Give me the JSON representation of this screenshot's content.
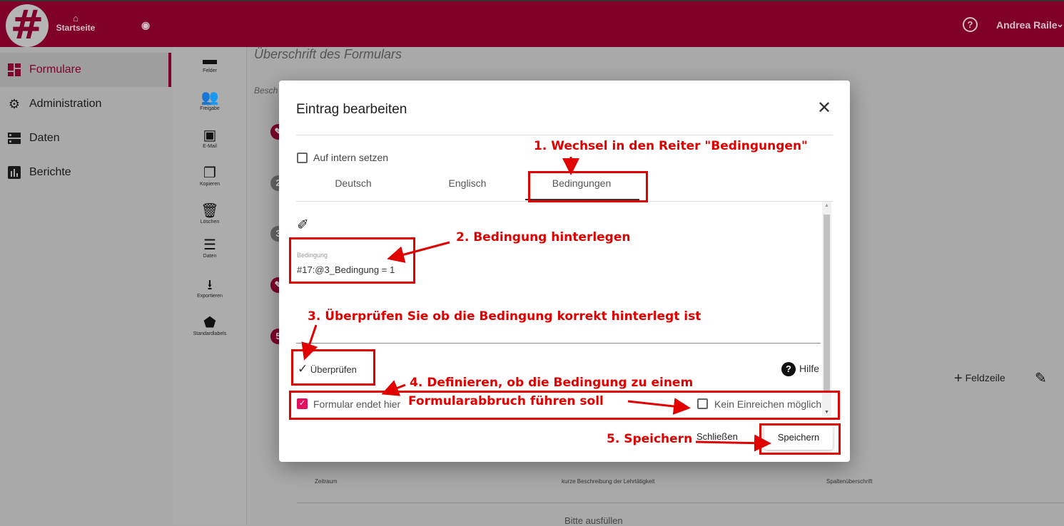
{
  "header": {
    "home_label": "Startseite",
    "user_name": "Andrea Raile",
    "brand_color": "#7f0029"
  },
  "sidebar": {
    "items": [
      {
        "label": "Formulare",
        "icon": "dashboard-icon",
        "active": true
      },
      {
        "label": "Administration",
        "icon": "gear-icon"
      },
      {
        "label": "Daten",
        "icon": "storage-icon"
      },
      {
        "label": "Berichte",
        "icon": "bar-chart-icon"
      }
    ]
  },
  "toolbar": {
    "items": [
      {
        "label": "Felder"
      },
      {
        "label": "Freigabe"
      },
      {
        "label": "E-Mail"
      },
      {
        "label": "Kopieren"
      },
      {
        "label": "Löschen"
      },
      {
        "label": "Daten"
      },
      {
        "label": "Exportieren"
      },
      {
        "label": "Standardlabels"
      }
    ]
  },
  "main": {
    "form_title": "Überschrift des Formulars",
    "desc_partial": "Besch",
    "step_numbers": [
      "2",
      "3",
      "5"
    ],
    "add_row_label": "Feldzeile",
    "table_headers": [
      "Zeitraum",
      "kurze Beschreibung der Lehrtätigkeit",
      "Spaltenüberschrift"
    ],
    "placeholder_row": "Bitte ausfüllen"
  },
  "dialog": {
    "title": "Eintrag bearbeiten",
    "internal_checkbox": {
      "label": "Auf intern setzen",
      "checked": false
    },
    "tabs": [
      "Deutsch",
      "Englisch",
      "Bedingungen"
    ],
    "active_tab": "Bedingungen",
    "condition_label": "Bedingung",
    "condition_value": "#17:@3_Bedingung = 1",
    "check_button": "Überprüfen",
    "help_label": "Hilfe",
    "form_ends_checkbox": {
      "label": "Formular endet hier",
      "checked": true
    },
    "no_submit_checkbox": {
      "label": "Kein Einreichen möglich",
      "checked": false
    },
    "close_button": "Schließen",
    "save_button": "Speichern"
  },
  "annotations": {
    "step1": "1. Wechsel in den Reiter \"Bedingungen\"",
    "step2": "2. Bedingung hinterlegen",
    "step3": "3. Überprüfen Sie ob die Bedingung korrekt hinterlegt ist",
    "step4_line1": "4. Definieren, ob die Bedingung zu einem",
    "step4_line2": "Formularabbruch führen soll",
    "step5": "5. Speichern",
    "color": "#e00000"
  }
}
